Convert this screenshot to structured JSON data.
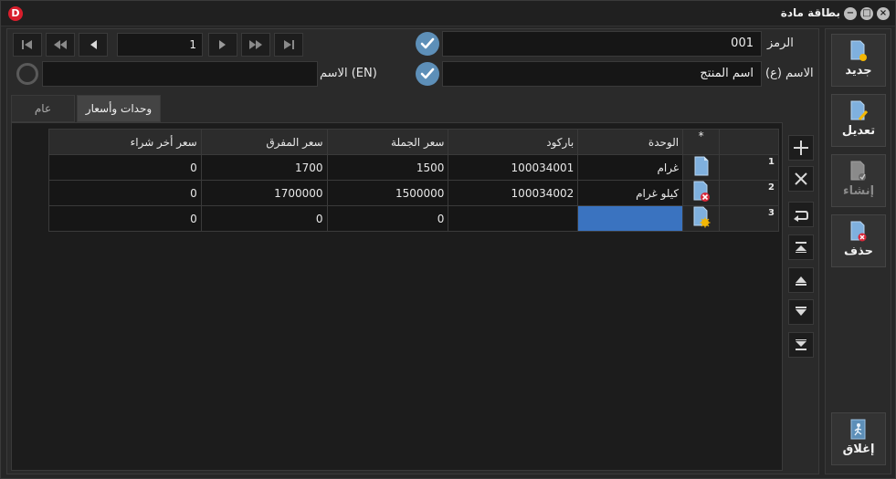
{
  "window": {
    "title": "بطاقة مادة",
    "logo_letter": "D",
    "minimize_glyph": "−",
    "maximize_glyph": "□",
    "close_glyph": "×"
  },
  "record": {
    "number": "1"
  },
  "form": {
    "code_label": "الرمز",
    "code_value": "001",
    "name_ar_label": "الاسم (ع)",
    "name_ar_value": "اسم المنتج",
    "name_en_label": "الاسم (EN)",
    "name_en_value": ""
  },
  "tabs": [
    {
      "label": "عام",
      "active": false
    },
    {
      "label": "وحدات وأسعار",
      "active": true
    }
  ],
  "grid": {
    "star_header": "*",
    "columns": [
      "الوحدة",
      "باركود",
      "سعر الجملة",
      "سعر المفرق",
      "سعر أخر شراء"
    ],
    "rows": [
      {
        "num": "1",
        "icon": "document-icon",
        "unit": "غرام",
        "barcode": "100034001",
        "wholesale": "1500",
        "retail": "1700",
        "last_purchase": "0"
      },
      {
        "num": "2",
        "icon": "document-delete-icon",
        "unit": "كيلو غرام",
        "barcode": "100034002",
        "wholesale": "1500000",
        "retail": "1700000",
        "last_purchase": "0"
      },
      {
        "num": "3",
        "icon": "document-new-icon",
        "unit": "",
        "barcode": "",
        "wholesale": "0",
        "retail": "0",
        "last_purchase": "0"
      }
    ]
  },
  "actions": {
    "new": "جديد",
    "edit": "تعديل",
    "create": "إنشاء",
    "delete": "حذف",
    "close": "إغلاق"
  },
  "colors": {
    "accent": "#5d8fb8",
    "selected_cell": "#3a73c0",
    "logo": "#d81e2c"
  }
}
